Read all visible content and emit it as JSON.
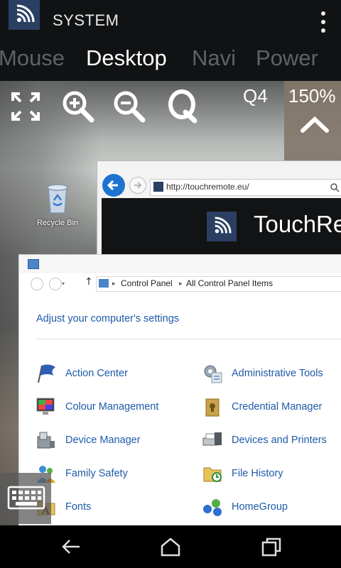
{
  "app": {
    "title": "SYSTEM"
  },
  "tabs": [
    {
      "label": "Mouse",
      "active": false
    },
    {
      "label": "Desktop",
      "active": true
    },
    {
      "label": "Navi",
      "active": false
    },
    {
      "label": "Power",
      "active": false
    }
  ],
  "toolbar": {
    "quality": "Q4",
    "zoom": "150%"
  },
  "desktop": {
    "recycle_bin_label": "Recycle Bin"
  },
  "browser": {
    "url": "http://touchremote.eu/",
    "site_title": "TouchRemote"
  },
  "control_panel": {
    "breadcrumb": [
      "Control Panel",
      "All Control Panel Items"
    ],
    "heading": "Adjust your computer's settings",
    "items": [
      {
        "label": "Action Center",
        "icon": "flag-icon"
      },
      {
        "label": "Administrative Tools",
        "icon": "admin-tools-icon"
      },
      {
        "label": "Colour Management",
        "icon": "colour-management-icon"
      },
      {
        "label": "Credential Manager",
        "icon": "credential-manager-icon"
      },
      {
        "label": "Device Manager",
        "icon": "device-manager-icon"
      },
      {
        "label": "Devices and Printers",
        "icon": "printer-icon"
      },
      {
        "label": "Family Safety",
        "icon": "family-safety-icon"
      },
      {
        "label": "File History",
        "icon": "file-history-icon"
      },
      {
        "label": "Fonts",
        "icon": "fonts-icon"
      },
      {
        "label": "HomeGroup",
        "icon": "homegroup-icon"
      }
    ]
  },
  "colors": {
    "accent": "#2b3f63",
    "link": "#1e5aa8",
    "app_bar": "#101214"
  }
}
